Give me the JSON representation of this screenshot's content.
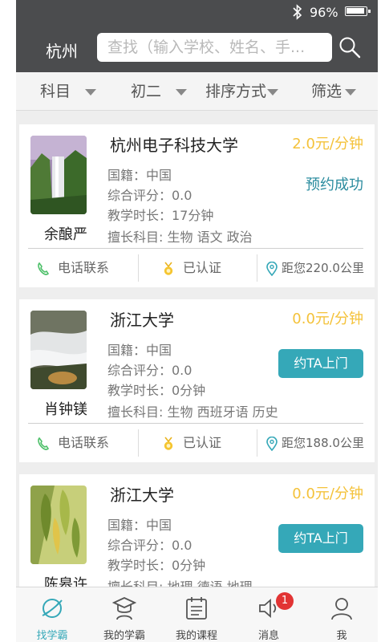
{
  "status_bar": {
    "battery": "96%"
  },
  "header": {
    "city": "杭州",
    "search_placeholder": "查找（输入学校、姓名、手..."
  },
  "filters": [
    {
      "label": "科目"
    },
    {
      "label": "初二"
    },
    {
      "label": "排序方式"
    },
    {
      "label": "筛选"
    }
  ],
  "teachers": [
    {
      "name": "余酿严",
      "university": "杭州电子科技大学",
      "price": "2.0元/分钟",
      "nationality": "国籍：中国",
      "rating": "综合评分：0.0",
      "duration": "教学时长：17分钟",
      "subjects": "擅长科目: 生物 语文 政治",
      "status": "预约成功",
      "call": "电话联系",
      "verified": "已认证",
      "distance": "距您220.0公里"
    },
    {
      "name": "肖钟镁",
      "university": "浙江大学",
      "price": "0.0元/分钟",
      "nationality": "国籍：中国",
      "rating": "综合评分：0.0",
      "duration": "教学时长：0分钟",
      "subjects": "擅长科目: 生物 西班牙语 历史",
      "action": "约TA上门",
      "call": "电话联系",
      "verified": "已认证",
      "distance": "距您188.0公里"
    },
    {
      "name": "陈皋许",
      "university": "浙江大学",
      "price": "0.0元/分钟",
      "nationality": "国籍：中国",
      "rating": "综合评分：0.0",
      "duration": "教学时长：0分钟",
      "subjects": "擅长科目: 地理 德语 地理",
      "action": "约TA上门"
    }
  ],
  "bottom_nav": [
    {
      "label": "找学霸",
      "icon": "planet-icon",
      "active": true
    },
    {
      "label": "我的学霸",
      "icon": "graduate-icon"
    },
    {
      "label": "我的课程",
      "icon": "calendar-icon"
    },
    {
      "label": "消息",
      "icon": "speaker-icon",
      "badge": "1"
    },
    {
      "label": "我",
      "icon": "user-icon"
    }
  ],
  "colors": {
    "accent": "#35a8b8",
    "price": "#f4c23a",
    "topbar": "#4b4c4e",
    "badge": "#e23434"
  }
}
